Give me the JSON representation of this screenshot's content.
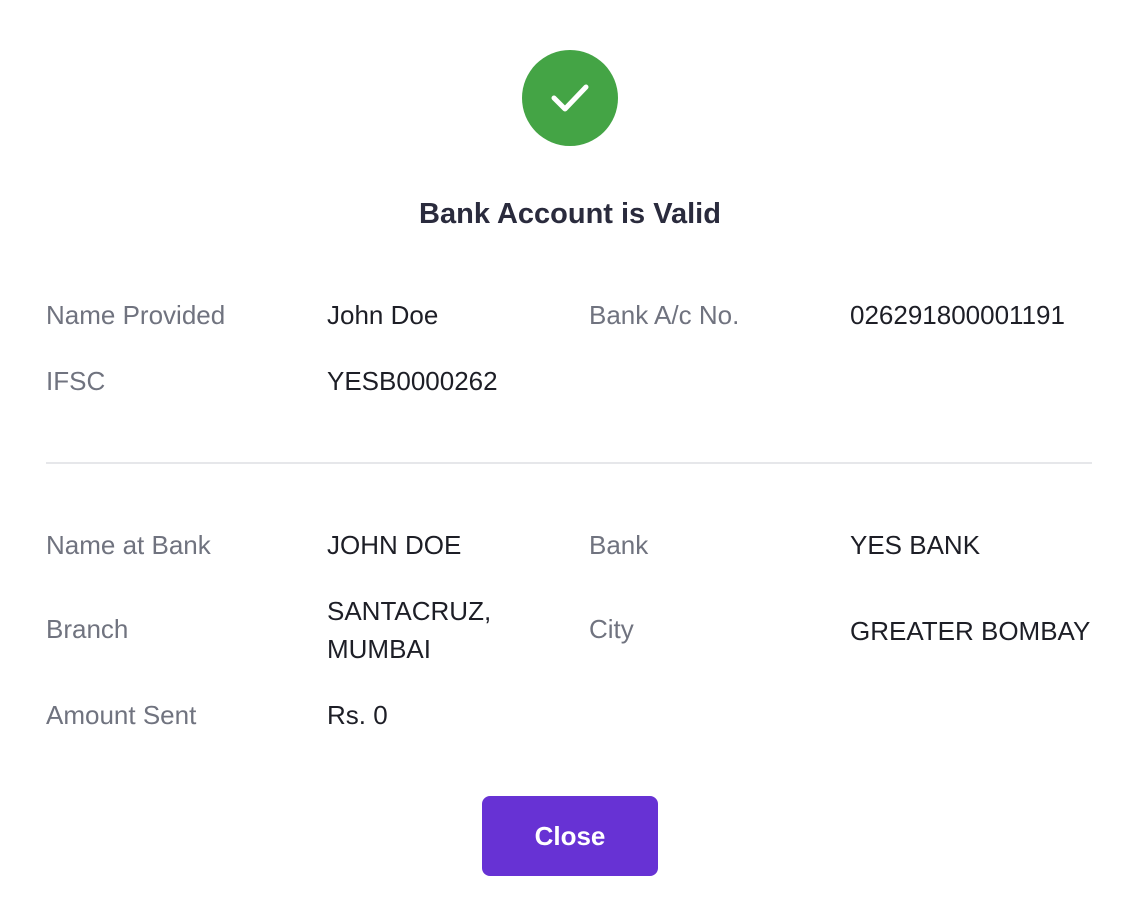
{
  "status": {
    "icon": "check-icon",
    "color": "#44a445",
    "title": "Bank Account is Valid"
  },
  "provided": {
    "name_label": "Name Provided",
    "name_value": "John Doe",
    "account_label": "Bank A/c No.",
    "account_value": "026291800001191",
    "ifsc_label": "IFSC",
    "ifsc_value": "YESB0000262"
  },
  "bank_details": {
    "name_label": "Name at Bank",
    "name_value": "JOHN DOE",
    "bank_label": "Bank",
    "bank_value": "YES BANK",
    "branch_label": "Branch",
    "branch_value_line1": "SANTACRUZ,",
    "branch_value_line2": "MUMBAI",
    "city_label": "City",
    "city_value": "GREATER BOMBAY",
    "amount_label": "Amount Sent",
    "amount_value": "Rs. 0"
  },
  "actions": {
    "close_label": "Close",
    "close_color": "#6732d4"
  }
}
